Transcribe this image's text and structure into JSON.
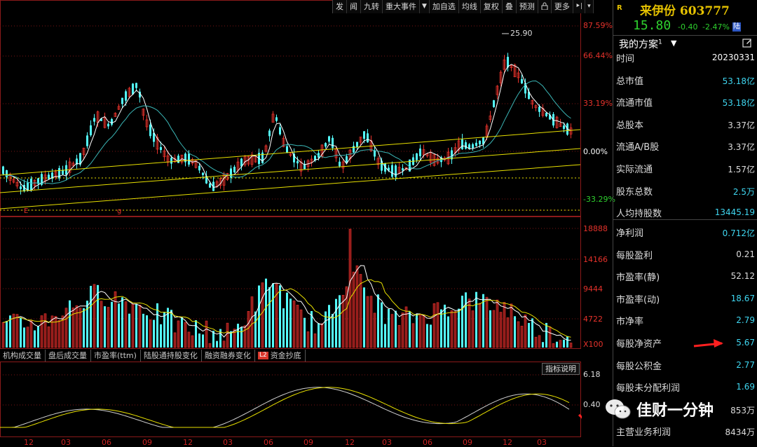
{
  "toolbar": {
    "buttons": [
      "发",
      "闻",
      "九转",
      "重大事件",
      "加自选",
      "均线",
      "复权",
      "叠",
      "预测",
      "更多"
    ],
    "arrow": "▼",
    "exit": "⯈|",
    "menu": "▾"
  },
  "price_axis": {
    "pct_labels": [
      "87.59%",
      "66.44%",
      "33.19%",
      "0.00%",
      "-33.29%"
    ],
    "high_label": "25.90"
  },
  "volume_axis": {
    "labels": [
      "18888",
      "14166",
      "9444",
      "4722",
      "X100"
    ]
  },
  "indicator_axis": {
    "labels": [
      "6.18",
      "0.40"
    ]
  },
  "indicator_tabs": [
    "机构成交量",
    "盘后成交量",
    "市盈率(ttm)",
    "陆股通持股变化",
    "融资融券变化",
    "资金抄底"
  ],
  "indicator_badge": "L2",
  "help_button": "指标说明",
  "x_axis": {
    "labels": [
      "12",
      "03",
      "06",
      "09",
      "12",
      "03",
      "06",
      "09",
      "12",
      "03",
      "06",
      "09",
      "12",
      "03"
    ]
  },
  "chart_markers": [
    "E",
    "g"
  ],
  "stock": {
    "r_mark": "R",
    "name_code": "来伊份 603777",
    "price": "15.80",
    "change": "-0.40",
    "change_pct": "-2.47%",
    "exchange": "陆",
    "color_down": "#2ed12e",
    "color_name": "#e6c200"
  },
  "plan": {
    "title": "我的方案",
    "index": "1",
    "tri": "▼"
  },
  "fundamentals_a": [
    {
      "k": "时间",
      "v": "20230331",
      "c": "#ffffff"
    },
    {
      "k": "总市值",
      "v": "53.18亿",
      "c": "#3fd6f0"
    },
    {
      "k": "流通市值",
      "v": "53.18亿",
      "c": "#3fd6f0"
    },
    {
      "k": "总股本",
      "v": "3.37亿",
      "c": "#dcdcdc"
    },
    {
      "k": "流通A/B股",
      "v": "3.37亿",
      "c": "#dcdcdc"
    },
    {
      "k": "实际流通",
      "v": "1.57亿",
      "c": "#dcdcdc"
    },
    {
      "k": "股东总数",
      "v": "2.5万",
      "c": "#3fd6f0"
    },
    {
      "k": "人均持股数",
      "v": "13445.19",
      "c": "#3fd6f0"
    }
  ],
  "fundamentals_b": [
    {
      "k": "净利润",
      "v": "0.712亿",
      "c": "#3fd6f0"
    },
    {
      "k": "每股盈利",
      "v": "0.21",
      "c": "#dcdcdc"
    },
    {
      "k": "市盈率(静)",
      "v": "52.12",
      "c": "#dcdcdc"
    },
    {
      "k": "市盈率(动)",
      "v": "18.67",
      "c": "#3fd6f0"
    },
    {
      "k": "市净率",
      "v": "2.79",
      "c": "#3fd6f0"
    },
    {
      "k": "每股净资产",
      "v": "5.67",
      "c": "#3fd6f0"
    },
    {
      "k": "每股公积金",
      "v": "2.77",
      "c": "#3fd6f0"
    },
    {
      "k": "每股未分配利润",
      "v": "1.69",
      "c": "#3fd6f0"
    },
    {
      "k": "",
      "v": "853万",
      "c": "#dcdcdc"
    },
    {
      "k": "主营业务利润",
      "v": "8434万",
      "c": "#dcdcdc"
    }
  ],
  "watermark": {
    "text": "佳财一分钟"
  },
  "colors": {
    "up": "#e6322b",
    "down": "#54fcfc",
    "ma_white": "#ffffff",
    "ma_yellow": "#e8e000",
    "ma_teal": "#3ab5b5",
    "annotation_red": "#ff2020"
  }
}
